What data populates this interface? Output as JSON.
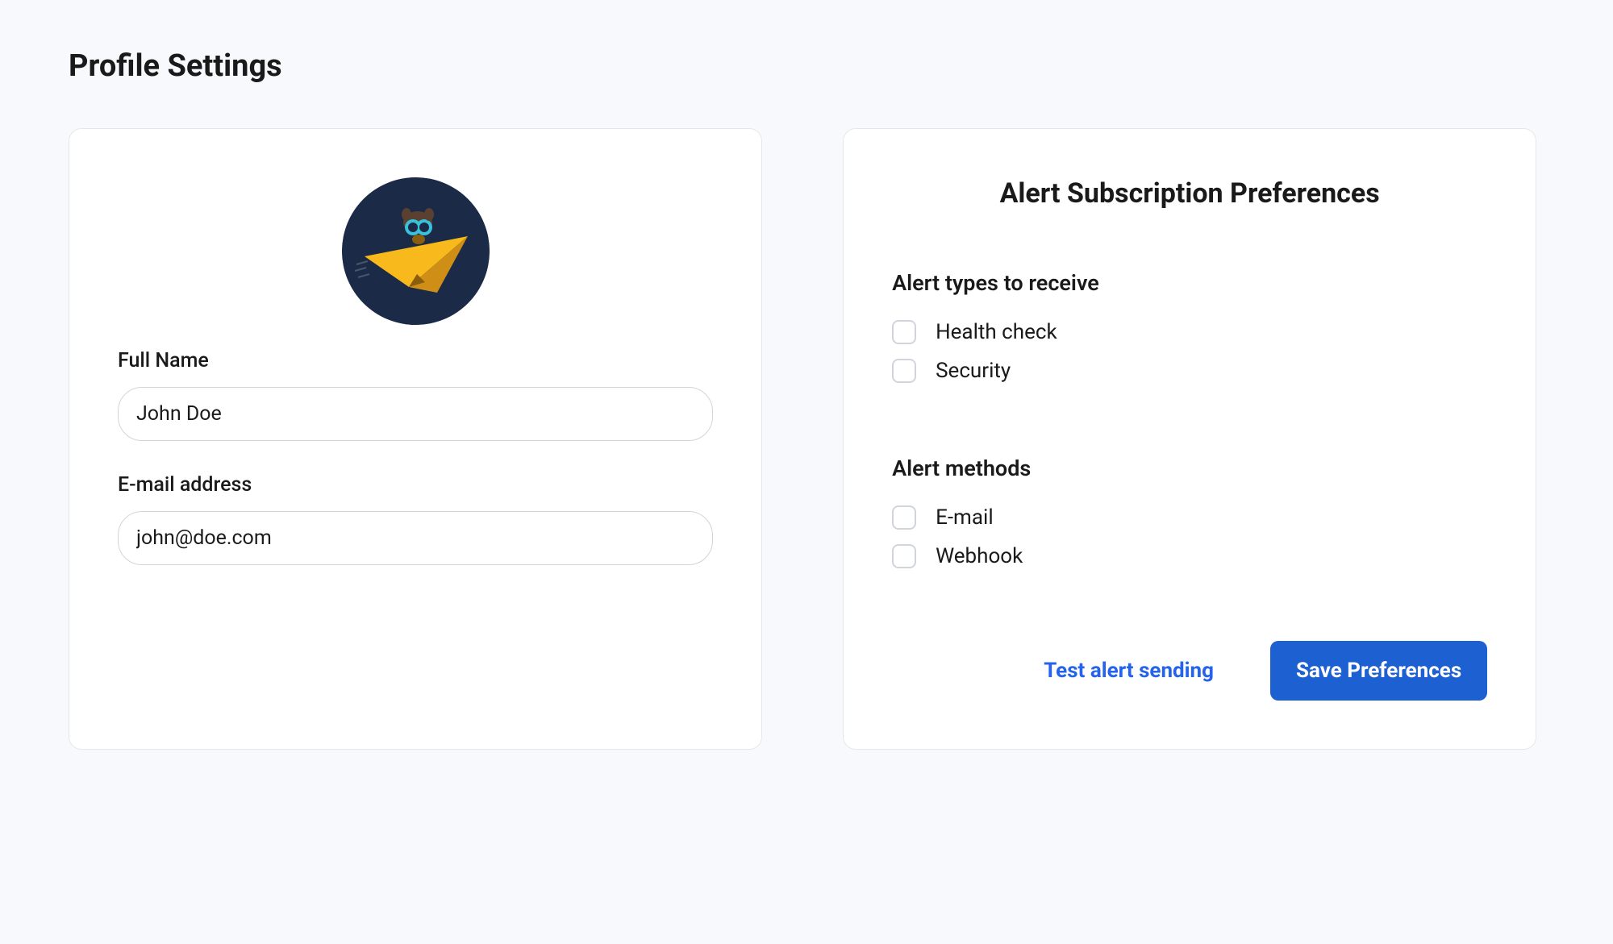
{
  "page": {
    "title": "Profile Settings"
  },
  "profile": {
    "full_name_label": "Full Name",
    "full_name_value": "John Doe",
    "email_label": "E-mail address",
    "email_value": "john@doe.com"
  },
  "alerts": {
    "title": "Alert Subscription Preferences",
    "types_heading": "Alert types to receive",
    "types": [
      {
        "label": "Health check",
        "checked": false
      },
      {
        "label": "Security",
        "checked": false
      }
    ],
    "methods_heading": "Alert methods",
    "methods": [
      {
        "label": "E-mail",
        "checked": false
      },
      {
        "label": "Webhook",
        "checked": false
      }
    ],
    "test_button": "Test alert sending",
    "save_button": "Save Preferences"
  },
  "colors": {
    "accent": "#1d60d1",
    "link": "#2563eb",
    "avatar_bg": "#1b2a47",
    "plane": "#fdbf1f"
  }
}
